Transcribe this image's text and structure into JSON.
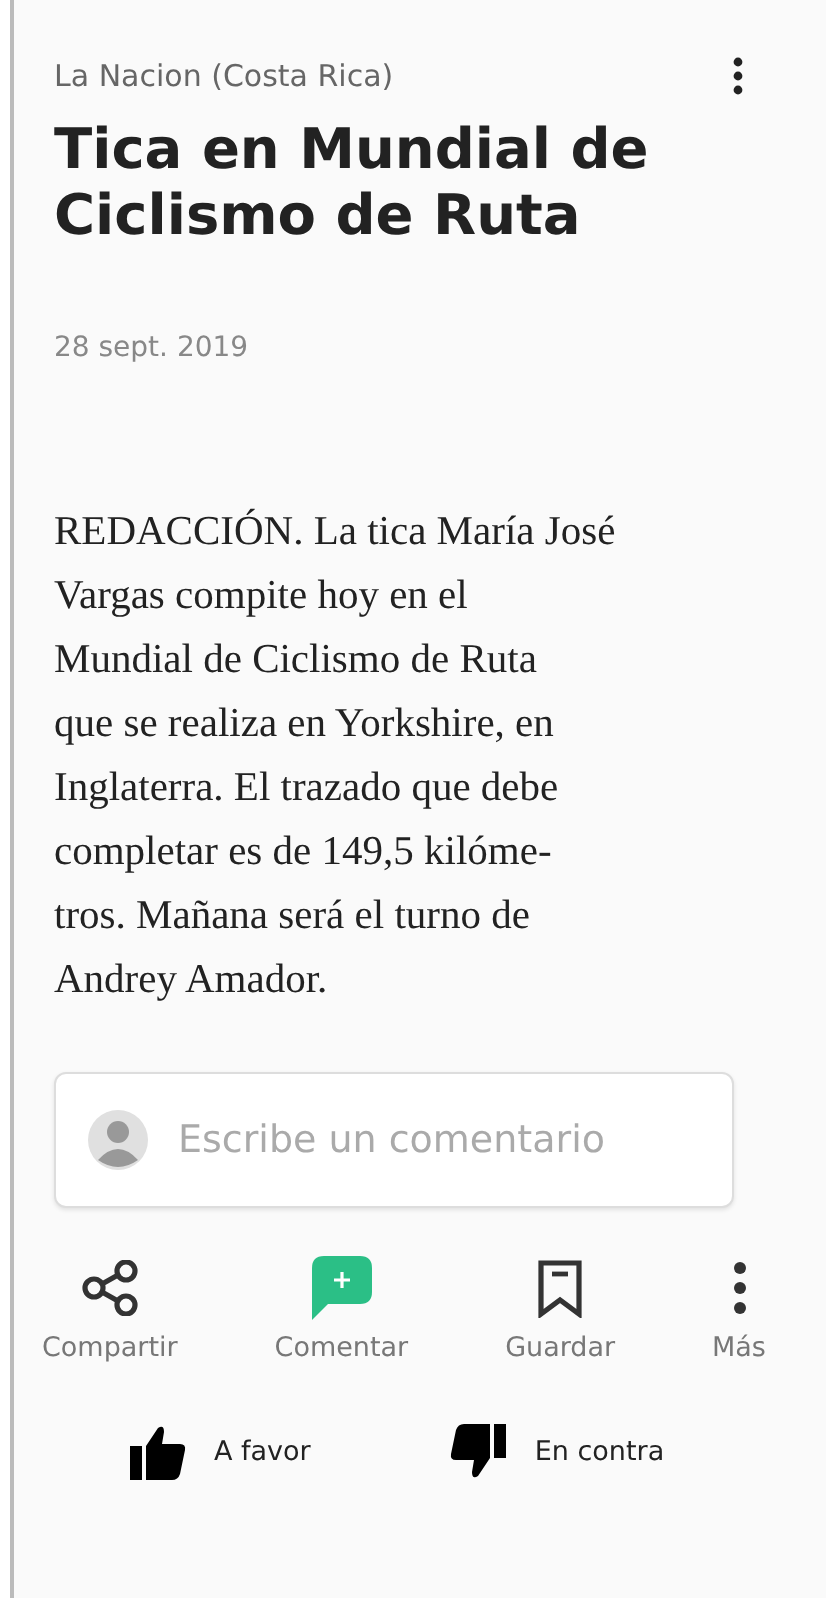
{
  "source": "La Nacion (Costa Rica)",
  "title": "Tica en Mundial de Ciclismo de Ruta",
  "date": "28 sept. 2019",
  "body_lines": [
    "REDACCIÓN. La tica María José",
    "Vargas compite hoy en el",
    "Mundial de Ciclismo de Ruta",
    "que se realiza en Yorkshire, en",
    "Inglaterra. El trazado que debe",
    "completar es de 149,5 kilóme-",
    "tros. Mañana será el turno de",
    "Andrey Amador."
  ],
  "comment": {
    "placeholder": "Escribe un comentario"
  },
  "actions": [
    {
      "kind": "share",
      "label": "Compartir"
    },
    {
      "kind": "comment",
      "label": "Comentar"
    },
    {
      "kind": "save",
      "label": "Guardar"
    },
    {
      "kind": "more",
      "label": "Más"
    }
  ],
  "votes": [
    {
      "kind": "up",
      "label": "A favor"
    },
    {
      "kind": "down",
      "label": "En contra"
    }
  ]
}
